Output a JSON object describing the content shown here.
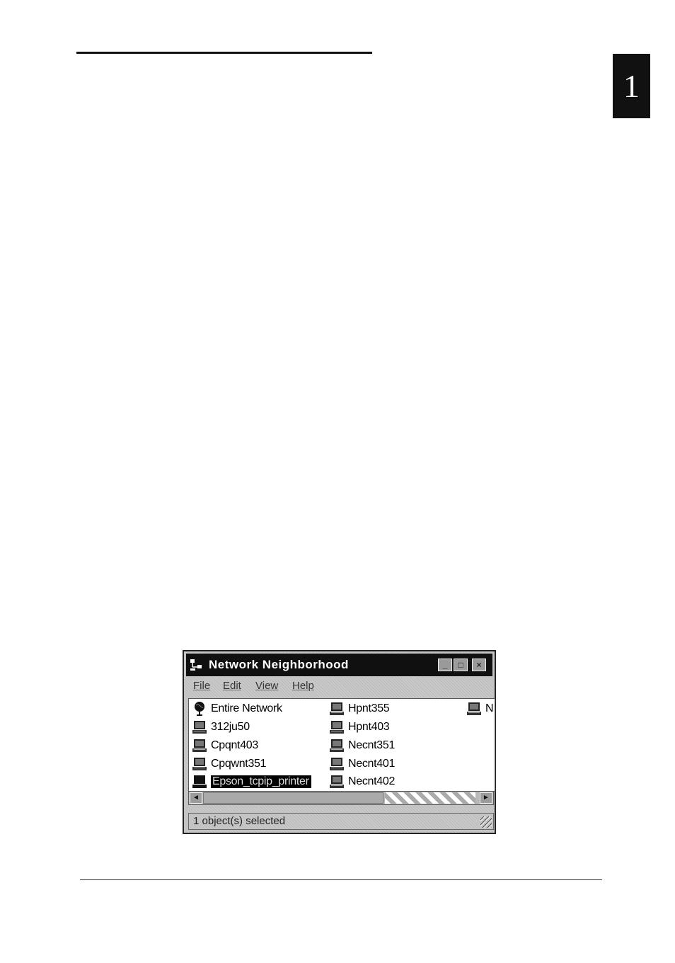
{
  "page": {
    "chapter_number": "1"
  },
  "window": {
    "title": "Network Neighborhood",
    "controls": {
      "minimize": "_",
      "maximize": "□",
      "close": "×"
    },
    "menu": [
      "File",
      "Edit",
      "View",
      "Help"
    ],
    "items": [
      {
        "label": "Entire Network",
        "icon": "globe-icon"
      },
      {
        "label": "312ju50",
        "icon": "computer-icon"
      },
      {
        "label": "Cpqnt403",
        "icon": "computer-icon"
      },
      {
        "label": "Cpqwnt351",
        "icon": "computer-icon"
      },
      {
        "label": "Epson_tcpip_printer",
        "icon": "computer-icon",
        "selected": true
      },
      {
        "label": "Hpnt355",
        "icon": "computer-icon"
      },
      {
        "label": "Hpnt403",
        "icon": "computer-icon"
      },
      {
        "label": "Necnt351",
        "icon": "computer-icon"
      },
      {
        "label": "Necnt401",
        "icon": "computer-icon"
      },
      {
        "label": "Necnt402",
        "icon": "computer-icon"
      },
      {
        "label": "N",
        "icon": "computer-icon"
      }
    ],
    "scroll": {
      "left_arrow": "◄",
      "right_arrow": "►"
    },
    "status": "1 object(s) selected"
  }
}
